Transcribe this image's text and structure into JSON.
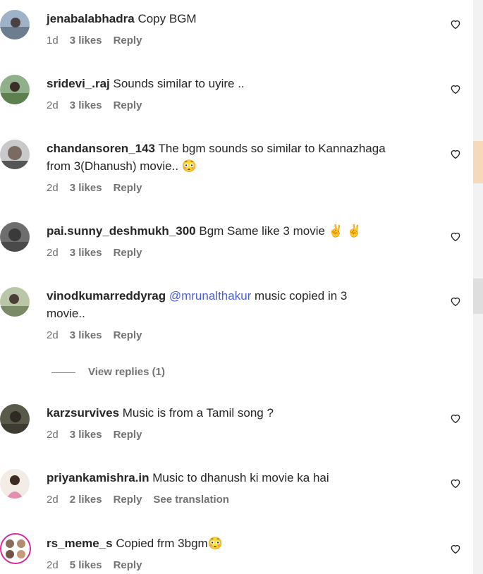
{
  "comments": [
    {
      "username": "jenabalabhadra",
      "text": "Copy BGM",
      "time": "1d",
      "likes": "3 likes",
      "reply": "Reply"
    },
    {
      "username": "sridevi_.raj",
      "text": "Sounds similar to uyire ..",
      "time": "2d",
      "likes": "3 likes",
      "reply": "Reply"
    },
    {
      "username": "chandansoren_143",
      "text": "The bgm sounds so similar to Kannazhaga",
      "text2": "from 3(Dhanush) movie..",
      "time": "2d",
      "likes": "3 likes",
      "reply": "Reply"
    },
    {
      "username": "pai.sunny_deshmukh_300",
      "text": "Bgm Same like 3 movie",
      "time": "2d",
      "likes": "3 likes",
      "reply": "Reply"
    },
    {
      "username": "vinodkumarreddyrag",
      "mention": "@mrunalthakur",
      "text": "music copied in 3",
      "text2": "movie..",
      "time": "2d",
      "likes": "3 likes",
      "reply": "Reply"
    },
    {
      "username": "karzsurvives",
      "text": "Music is from a Tamil song ?",
      "time": "2d",
      "likes": "3 likes",
      "reply": "Reply"
    },
    {
      "username": "priyankamishra.in",
      "text": "Music to dhanush ki movie ka hai",
      "time": "2d",
      "likes": "2 likes",
      "reply": "Reply",
      "translate": "See translation"
    },
    {
      "username": "rs_meme_s",
      "text": "Copied frm 3bgm",
      "time": "2d",
      "likes": "5 likes",
      "reply": "Reply"
    }
  ],
  "view_replies": "View replies (1)",
  "icons": {
    "like": "heart-outline-icon",
    "emoji_flushed": "flushed-face-emoji",
    "emoji_victory": "victory-hand-emoji"
  }
}
